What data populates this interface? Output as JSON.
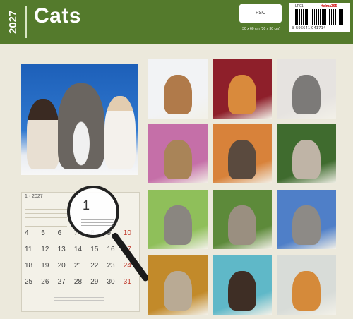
{
  "header": {
    "year": "2027",
    "title": "Cats",
    "fsc_label": "FSC",
    "size": "30 x 60 cm (30 x 30 cm)",
    "product_code": "LP01",
    "brand": "Helma365",
    "ean": "8 596641 041714"
  },
  "calendar": {
    "month_label": "1 · 2027",
    "days": [
      {
        "d": "4",
        "sun": false
      },
      {
        "d": "5",
        "sun": false
      },
      {
        "d": "6",
        "sun": false
      },
      {
        "d": "7",
        "sun": false
      },
      {
        "d": "8",
        "sun": false
      },
      {
        "d": "9",
        "sun": false
      },
      {
        "d": "10",
        "sun": true
      },
      {
        "d": "11",
        "sun": false
      },
      {
        "d": "12",
        "sun": false
      },
      {
        "d": "13",
        "sun": false
      },
      {
        "d": "14",
        "sun": false
      },
      {
        "d": "15",
        "sun": false
      },
      {
        "d": "16",
        "sun": false
      },
      {
        "d": "17",
        "sun": true
      },
      {
        "d": "18",
        "sun": false
      },
      {
        "d": "19",
        "sun": false
      },
      {
        "d": "20",
        "sun": false
      },
      {
        "d": "21",
        "sun": false
      },
      {
        "d": "22",
        "sun": false
      },
      {
        "d": "23",
        "sun": false
      },
      {
        "d": "24",
        "sun": true
      },
      {
        "d": "25",
        "sun": false
      },
      {
        "d": "26",
        "sun": false
      },
      {
        "d": "27",
        "sun": false
      },
      {
        "d": "28",
        "sun": false
      },
      {
        "d": "29",
        "sun": false
      },
      {
        "d": "30",
        "sun": false
      },
      {
        "d": "31",
        "sun": true
      }
    ],
    "magnified_day": "1"
  },
  "thumbnails": [
    {
      "bg": "#f2f3f5",
      "cat": "#b07a4a"
    },
    {
      "bg": "#8e1f2a",
      "cat": "#d98a3c"
    },
    {
      "bg": "#e6e3e0",
      "cat": "#7c7a78"
    },
    {
      "bg": "#c56fa8",
      "cat": "#a98458"
    },
    {
      "bg": "#d8823a",
      "cat": "#5a4a3e"
    },
    {
      "bg": "#3f6b2e",
      "cat": "#bfb4a6"
    },
    {
      "bg": "#8fbf5a",
      "cat": "#8a8680"
    },
    {
      "bg": "#5d8a3a",
      "cat": "#9a8f80"
    },
    {
      "bg": "#4f7fc8",
      "cat": "#8d8a86"
    },
    {
      "bg": "#c28a2a",
      "cat": "#b9aa94"
    },
    {
      "bg": "#5fb8c8",
      "cat": "#3e2e25"
    },
    {
      "bg": "#d8dcd8",
      "cat": "#d58a3a"
    }
  ]
}
